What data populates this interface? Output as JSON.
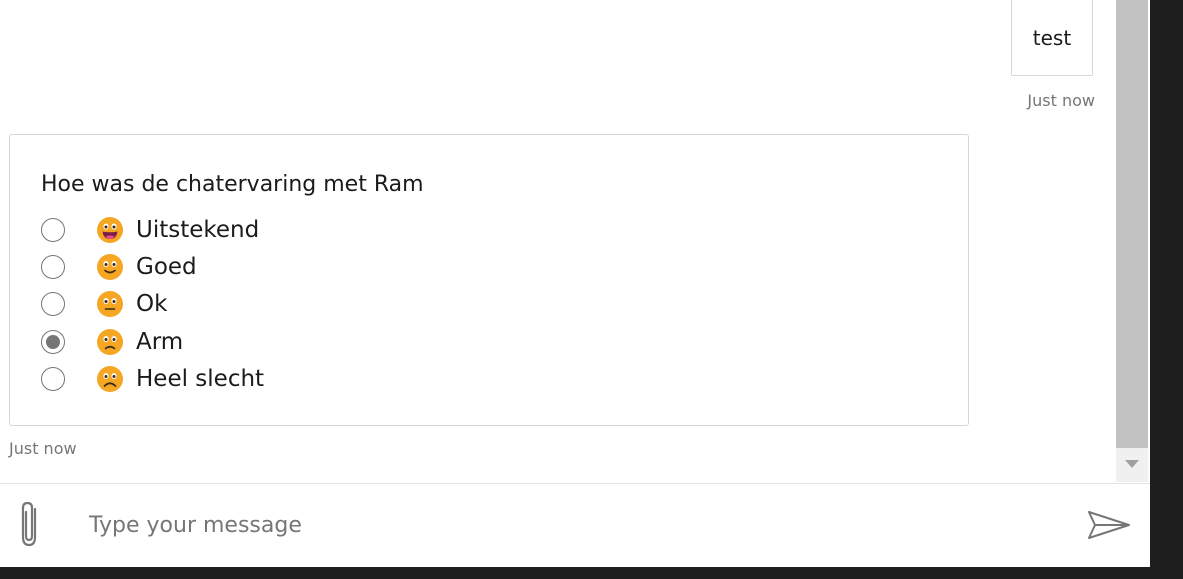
{
  "transcript": {
    "user_message": {
      "text": "test",
      "timestamp": "Just now"
    },
    "bot_card": {
      "title": "Hoe was de chatervaring met Ram",
      "timestamp": "Just now",
      "selected_index": 3,
      "choices": [
        {
          "label": "Uitstekend",
          "icon": "grinning-face-icon"
        },
        {
          "label": "Goed",
          "icon": "slightly-smiling-face-icon"
        },
        {
          "label": "Ok",
          "icon": "neutral-face-icon"
        },
        {
          "label": "Arm",
          "icon": "slightly-frowning-face-icon"
        },
        {
          "label": "Heel slecht",
          "icon": "frowning-face-icon"
        }
      ]
    }
  },
  "composer": {
    "placeholder": "Type your message",
    "value": ""
  },
  "colors": {
    "emoji_face": "#F5A623",
    "radio_border": "#767676",
    "timestamp": "#767676",
    "scroll_thumb": "#C2C2C2"
  }
}
